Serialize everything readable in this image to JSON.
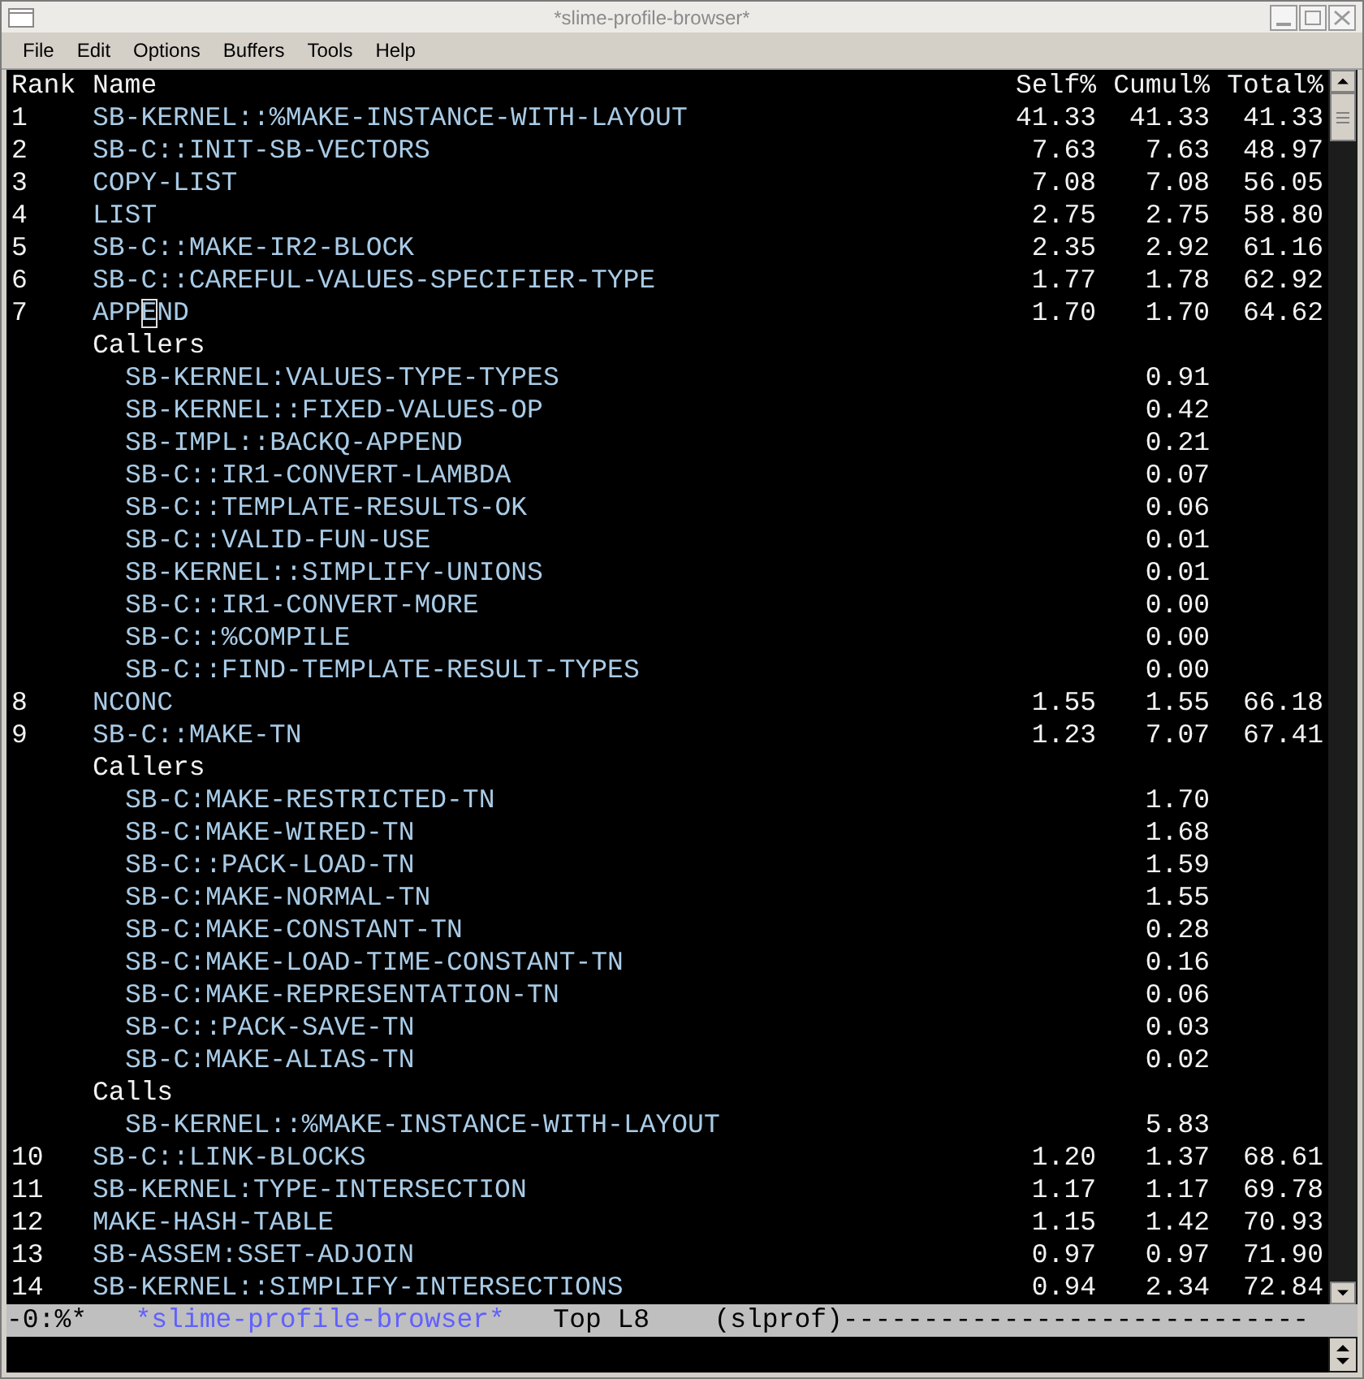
{
  "window": {
    "title": "*slime-profile-browser*"
  },
  "menu": [
    "File",
    "Edit",
    "Options",
    "Buffers",
    "Tools",
    "Help"
  ],
  "header": {
    "rank": "Rank",
    "name": "Name",
    "self": "Self%",
    "cumul": "Cumul%",
    "total": "Total%"
  },
  "entries": [
    {
      "rank": "1",
      "name": "SB-KERNEL::%MAKE-INSTANCE-WITH-LAYOUT",
      "self": "41.33",
      "cumul": "41.33",
      "total": "41.33",
      "cursor": false
    },
    {
      "rank": "2",
      "name": "SB-C::INIT-SB-VECTORS",
      "self": "7.63",
      "cumul": "7.63",
      "total": "48.97",
      "cursor": false
    },
    {
      "rank": "3",
      "name": "COPY-LIST",
      "self": "7.08",
      "cumul": "7.08",
      "total": "56.05",
      "cursor": false
    },
    {
      "rank": "4",
      "name": "LIST",
      "self": "2.75",
      "cumul": "2.75",
      "total": "58.80",
      "cursor": false
    },
    {
      "rank": "5",
      "name": "SB-C::MAKE-IR2-BLOCK",
      "self": "2.35",
      "cumul": "2.92",
      "total": "61.16",
      "cursor": false
    },
    {
      "rank": "6",
      "name": "SB-C::CAREFUL-VALUES-SPECIFIER-TYPE",
      "self": "1.77",
      "cumul": "1.78",
      "total": "62.92",
      "cursor": false
    },
    {
      "rank": "7",
      "name": "APPEND",
      "self": "1.70",
      "cumul": "1.70",
      "total": "64.62",
      "cursor": true,
      "sections": [
        {
          "label": "Callers",
          "items": [
            {
              "name": "SB-KERNEL:VALUES-TYPE-TYPES",
              "value": "0.91"
            },
            {
              "name": "SB-KERNEL::FIXED-VALUES-OP",
              "value": "0.42"
            },
            {
              "name": "SB-IMPL::BACKQ-APPEND",
              "value": "0.21"
            },
            {
              "name": "SB-C::IR1-CONVERT-LAMBDA",
              "value": "0.07"
            },
            {
              "name": "SB-C::TEMPLATE-RESULTS-OK",
              "value": "0.06"
            },
            {
              "name": "SB-C::VALID-FUN-USE",
              "value": "0.01"
            },
            {
              "name": "SB-KERNEL::SIMPLIFY-UNIONS",
              "value": "0.01"
            },
            {
              "name": "SB-C::IR1-CONVERT-MORE",
              "value": "0.00"
            },
            {
              "name": "SB-C::%COMPILE",
              "value": "0.00"
            },
            {
              "name": "SB-C::FIND-TEMPLATE-RESULT-TYPES",
              "value": "0.00"
            }
          ]
        }
      ]
    },
    {
      "rank": "8",
      "name": "NCONC",
      "self": "1.55",
      "cumul": "1.55",
      "total": "66.18",
      "cursor": false
    },
    {
      "rank": "9",
      "name": "SB-C::MAKE-TN",
      "self": "1.23",
      "cumul": "7.07",
      "total": "67.41",
      "cursor": false,
      "sections": [
        {
          "label": "Callers",
          "items": [
            {
              "name": "SB-C:MAKE-RESTRICTED-TN",
              "value": "1.70"
            },
            {
              "name": "SB-C:MAKE-WIRED-TN",
              "value": "1.68"
            },
            {
              "name": "SB-C::PACK-LOAD-TN",
              "value": "1.59"
            },
            {
              "name": "SB-C:MAKE-NORMAL-TN",
              "value": "1.55"
            },
            {
              "name": "SB-C:MAKE-CONSTANT-TN",
              "value": "0.28"
            },
            {
              "name": "SB-C:MAKE-LOAD-TIME-CONSTANT-TN",
              "value": "0.16"
            },
            {
              "name": "SB-C:MAKE-REPRESENTATION-TN",
              "value": "0.06"
            },
            {
              "name": "SB-C::PACK-SAVE-TN",
              "value": "0.03"
            },
            {
              "name": "SB-C:MAKE-ALIAS-TN",
              "value": "0.02"
            }
          ]
        },
        {
          "label": "Calls",
          "items": [
            {
              "name": "SB-KERNEL::%MAKE-INSTANCE-WITH-LAYOUT",
              "value": "5.83"
            }
          ]
        }
      ]
    },
    {
      "rank": "10",
      "name": "SB-C::LINK-BLOCKS",
      "self": "1.20",
      "cumul": "1.37",
      "total": "68.61",
      "cursor": false
    },
    {
      "rank": "11",
      "name": "SB-KERNEL:TYPE-INTERSECTION",
      "self": "1.17",
      "cumul": "1.17",
      "total": "69.78",
      "cursor": false
    },
    {
      "rank": "12",
      "name": "MAKE-HASH-TABLE",
      "self": "1.15",
      "cumul": "1.42",
      "total": "70.93",
      "cursor": false
    },
    {
      "rank": "13",
      "name": "SB-ASSEM:SSET-ADJOIN",
      "self": "0.97",
      "cumul": "0.97",
      "total": "71.90",
      "cursor": false
    },
    {
      "rank": "14",
      "name": "SB-KERNEL::SIMPLIFY-INTERSECTIONS",
      "self": "0.94",
      "cumul": "2.34",
      "total": "72.84",
      "cursor": false
    }
  ],
  "mode_line": {
    "status": "-0:%*",
    "buffer": "*slime-profile-browser*",
    "position": "Top L8",
    "mode": "(slprof)",
    "fill": "-----------------------------"
  }
}
